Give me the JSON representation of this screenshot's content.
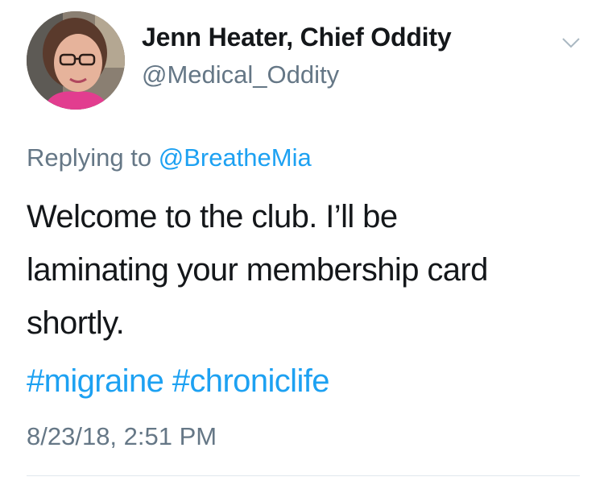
{
  "author": {
    "display_name": "Jenn Heater, Chief Oddity",
    "handle": "@Medical_Oddity"
  },
  "reply": {
    "prefix": "Replying to",
    "mention": "@BreatheMia"
  },
  "tweet": {
    "lines": [
      "Welcome to the club. I’ll be",
      "laminating your membership card",
      "shortly."
    ],
    "hashtags": [
      "#migraine",
      "#chroniclife"
    ]
  },
  "timestamp": "8/23/18, 2:51 PM",
  "colors": {
    "link": "#1da1f2",
    "secondary_text": "#657786",
    "primary_text": "#14171a",
    "divider": "#e1e8ed"
  },
  "icons": {
    "more": "chevron-down-icon"
  }
}
